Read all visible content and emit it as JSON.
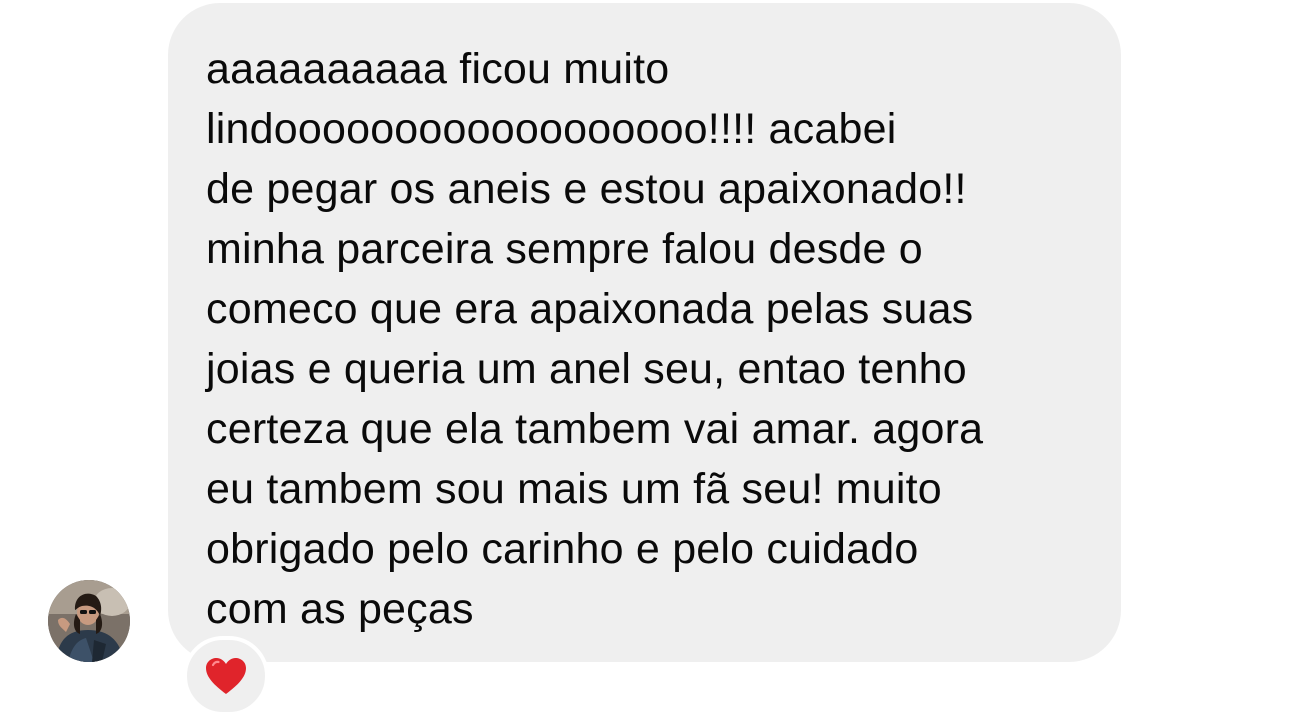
{
  "message": {
    "lines": [
      "aaaaaaaaaa ficou muito",
      "lindoooooooooooooooooo!!!! acabei",
      "de pegar os aneis e estou apaixonado!!",
      "minha parceira sempre falou desde o",
      "comeco que era apaixonada pelas suas",
      "joias e queria um anel seu, entao tenho",
      "certeza que ela tambem vai amar. agora",
      "eu tambem sou mais um fã seu! muito",
      "obrigado pelo carinho e pelo cuidado",
      "com as peças"
    ],
    "bubble_color": "#efefef",
    "text_color": "#0a0a0a"
  },
  "sender": {
    "avatar_icon": "profile-photo"
  },
  "reaction": {
    "icon": "red-heart-icon",
    "color": "#e0242b"
  }
}
